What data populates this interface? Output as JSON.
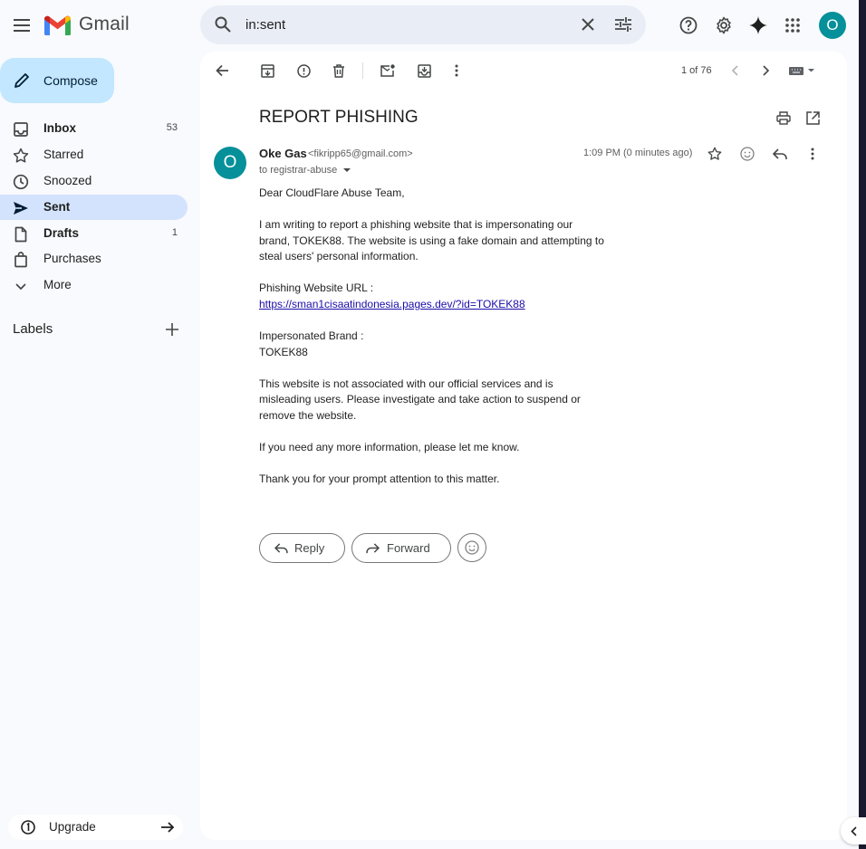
{
  "header": {
    "app_name": "Gmail",
    "search_value": "in:sent"
  },
  "sidebar": {
    "compose_label": "Compose",
    "items": [
      {
        "label": "Inbox",
        "count": "53",
        "bold": true,
        "icon": "inbox-icon"
      },
      {
        "label": "Starred",
        "count": "",
        "icon": "star-icon"
      },
      {
        "label": "Snoozed",
        "count": "",
        "icon": "clock-icon"
      },
      {
        "label": "Sent",
        "count": "",
        "bold": true,
        "active": true,
        "icon": "send-icon"
      },
      {
        "label": "Drafts",
        "count": "1",
        "bold": true,
        "icon": "draft-icon"
      },
      {
        "label": "Purchases",
        "count": "",
        "icon": "bag-icon"
      },
      {
        "label": "More",
        "count": "",
        "icon": "chevron-down-icon"
      }
    ],
    "labels_title": "Labels",
    "upgrade_label": "Upgrade"
  },
  "toolbar": {
    "pager": "1 of 76"
  },
  "email": {
    "subject": "REPORT PHISHING",
    "sender_initial": "O",
    "sender_name": "Oke Gas",
    "sender_email": "<fikripp65@gmail.com>",
    "to_line": "to registrar-abuse",
    "time": "1:09 PM (0 minutes ago)",
    "body": {
      "greeting": "Dear CloudFlare Abuse Team,",
      "para1_l1": "I am writing to report a phishing website that is impersonating our",
      "para1_l2": "brand, TOKEK88. The website is using a fake domain and attempting to",
      "para1_l3": "steal users' personal information.",
      "url_label": "Phishing Website URL :",
      "url": "https://sman1cisaatindonesia.pages.dev/?id=TOKEK88",
      "brand_label": "Impersonated Brand :",
      "brand": "TOKEK88",
      "para2_l1": "This website is not associated with our official services and is",
      "para2_l2": "misleading users. Please investigate and take action to suspend or",
      "para2_l3": "remove the website.",
      "para3": "If you need any more information, please let me know.",
      "para4": "Thank you for your prompt attention to this matter."
    },
    "reply_label": "Reply",
    "forward_label": "Forward"
  },
  "user": {
    "avatar_initial": "O"
  },
  "colors": {
    "accent": "#05909a",
    "compose_bg": "#c2e7ff",
    "active_nav": "#d3e3fd",
    "link": "#1a0dab"
  }
}
